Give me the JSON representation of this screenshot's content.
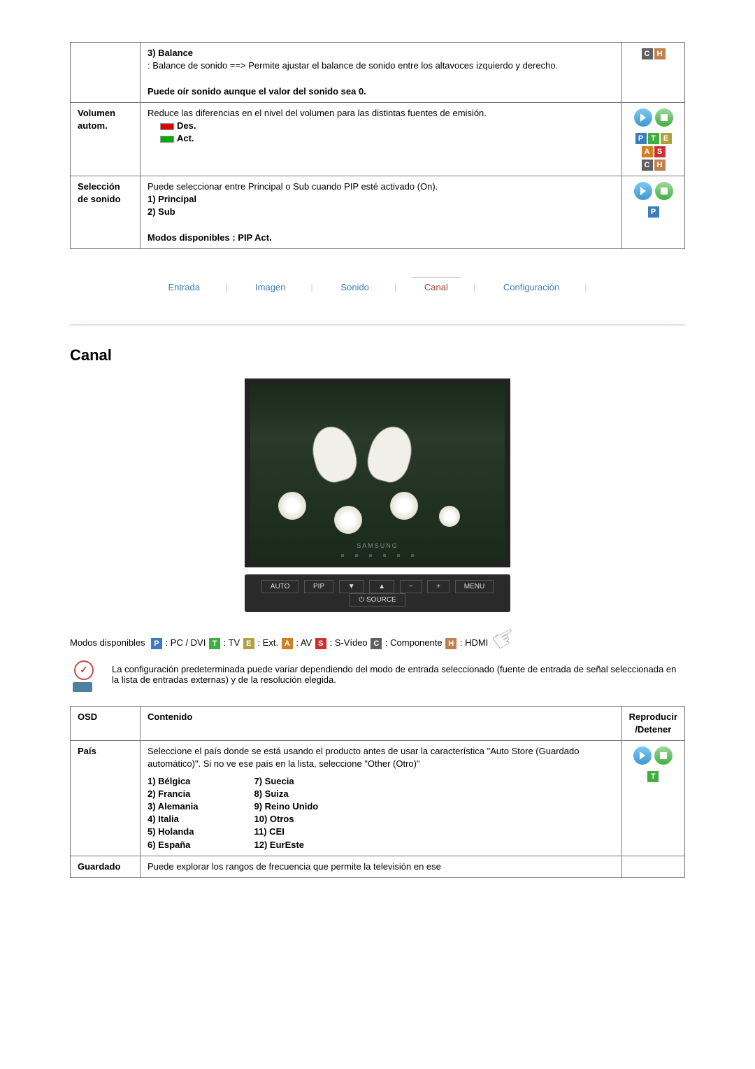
{
  "top_table": {
    "rows": [
      {
        "label": "",
        "content_title": "3) Balance",
        "content_desc": ": Balance de sonido ==> Permite ajustar el balance de sonido entre los altavoces izquierdo y derecho.",
        "content_note": "Puede oír sonido aunque el valor del sonido sea 0.",
        "icons": [
          "C",
          "H"
        ]
      },
      {
        "label": "Volumen autom.",
        "content_desc": "Reduce las diferencias en el nivel del volumen para las distintas fuentes de emisión.",
        "opt1": "Des.",
        "opt2": "Act.",
        "icons": [
          "P",
          "T",
          "E",
          "A",
          "S",
          "C",
          "H"
        ],
        "nav": true
      },
      {
        "label": "Selección de sonido",
        "content_desc": "Puede seleccionar entre Principal o Sub cuando PIP esté activado (On).",
        "opt1b": "1) Principal",
        "opt2b": "2) Sub",
        "content_note": "Modos disponibles : PIP Act.",
        "icons": [
          "P"
        ],
        "nav": true
      }
    ]
  },
  "tabs": [
    "Entrada",
    "Imagen",
    "Sonido",
    "Canal",
    "Configuración"
  ],
  "active_tab_index": 3,
  "section_title": "Canal",
  "tv_brand": "SAMSUNG",
  "panel_buttons": [
    "AUTO",
    "PIP",
    "▼",
    "▲",
    "−",
    "+",
    "MENU",
    "⏻ SOURCE"
  ],
  "modos_label": "Modos disponibles",
  "modos": [
    {
      "badge": "P",
      "text": ": PC / DVI"
    },
    {
      "badge": "T",
      "text": ": TV"
    },
    {
      "badge": "E",
      "text": ": Ext."
    },
    {
      "badge": "A",
      "text": ": AV"
    },
    {
      "badge": "S",
      "text": ": S-Vídeo"
    },
    {
      "badge": "C",
      "text": ": Componente"
    },
    {
      "badge": "H",
      "text": ": HDMI"
    }
  ],
  "note_text": "La configuración predeterminada puede variar dependiendo del modo de entrada seleccionado (fuente de entrada de señal seleccionada en la lista de entradas externas) y de la resolución elegida.",
  "bottom_table": {
    "headers": [
      "OSD",
      "Contenido",
      "Reproducir /Detener"
    ],
    "pais_label": "País",
    "pais_desc": "Seleccione el país donde se está usando el producto antes de usar la característica \"Auto Store (Guardado automático)\". Si no ve ese país en la lista, seleccione \"Other (Otro)\"",
    "pais_col1": [
      "1) Bélgica",
      "2) Francia",
      "3) Alemania",
      "4) Italia",
      "5) Holanda",
      "6) España"
    ],
    "pais_col2": [
      "7) Suecia",
      "8) Suiza",
      "9) Reino Unido",
      "10) Otros",
      "11) CEI",
      "12) EurEste"
    ],
    "pais_icons": [
      "T"
    ],
    "guardado_label": "Guardado",
    "guardado_desc": "Puede explorar los rangos de frecuencia que permite la televisión en ese"
  }
}
